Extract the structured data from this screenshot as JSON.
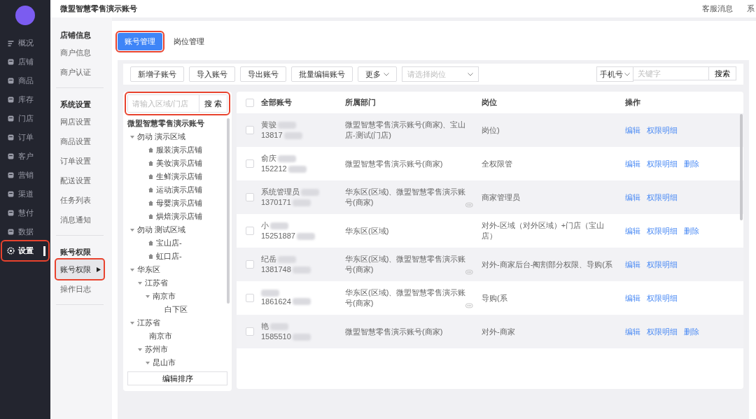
{
  "header": {
    "title": "微盟智慧零售演示账号",
    "links": [
      "客服消息",
      "系"
    ]
  },
  "nav": [
    {
      "label": "概况",
      "selected": false
    },
    {
      "label": "店铺",
      "selected": false
    },
    {
      "label": "商品",
      "selected": false
    },
    {
      "label": "库存",
      "selected": false
    },
    {
      "label": "门店",
      "selected": false
    },
    {
      "label": "订单",
      "selected": false
    },
    {
      "label": "客户",
      "selected": false
    },
    {
      "label": "营销",
      "selected": false
    },
    {
      "label": "渠道",
      "selected": false
    },
    {
      "label": "慧付",
      "selected": false
    },
    {
      "label": "数据",
      "selected": false
    },
    {
      "label": "设置",
      "selected": true,
      "highlighted": true
    }
  ],
  "submenu": [
    {
      "heading": "店铺信息",
      "items": [
        {
          "label": "商户信息",
          "selected": false
        },
        {
          "label": "商户认证",
          "selected": false
        }
      ]
    },
    {
      "heading": "系统设置",
      "items": [
        {
          "label": "网店设置",
          "selected": false
        },
        {
          "label": "商品设置",
          "selected": false
        },
        {
          "label": "订单设置",
          "selected": false
        },
        {
          "label": "配送设置",
          "selected": false
        },
        {
          "label": "任务列表",
          "selected": false
        },
        {
          "label": "消息通知",
          "selected": false
        }
      ]
    },
    {
      "heading": "账号权限",
      "items": [
        {
          "label": "账号权限",
          "selected": true,
          "highlighted": true
        },
        {
          "label": "操作日志",
          "selected": false
        }
      ]
    }
  ],
  "tabs": [
    {
      "label": "账号管理",
      "selected": true,
      "highlighted": true
    },
    {
      "label": "岗位管理",
      "selected": false
    }
  ],
  "toolbar": {
    "buttons": [
      "新增子账号",
      "导入账号",
      "导出账号",
      "批量编辑账号"
    ],
    "more": "更多",
    "role_select": {
      "placeholder": "请选择岗位"
    },
    "search_type": "手机号",
    "search": {
      "placeholder": "关键字"
    },
    "search_button": "搜索"
  },
  "tree": {
    "search": {
      "placeholder": "请输入区域/门店",
      "highlighted": true
    },
    "search_button": "搜 索",
    "root": "微盟智慧零售演示账号",
    "sort_button": "编辑排序",
    "items": [
      {
        "label": "勿动 演示区域",
        "kind": "area",
        "expanded": true,
        "children": [
          {
            "label": "服装演示店铺",
            "kind": "store"
          },
          {
            "label": "美妆演示店铺",
            "kind": "store"
          },
          {
            "label": "生鲜演示店铺",
            "kind": "store"
          },
          {
            "label": "运动演示店铺",
            "kind": "store"
          },
          {
            "label": "母婴演示店铺",
            "kind": "store"
          },
          {
            "label": "烘焙演示店铺",
            "kind": "store"
          }
        ]
      },
      {
        "label": "勿动 测试区域",
        "kind": "area",
        "expanded": true,
        "children": [
          {
            "label": "宝山店-",
            "kind": "store"
          },
          {
            "label": "虹口店-",
            "kind": "store"
          }
        ]
      },
      {
        "label": "华东区",
        "kind": "area",
        "expanded": true,
        "children": [
          {
            "label": "江苏省",
            "kind": "area",
            "expanded": true,
            "children": [
              {
                "label": "南京市",
                "kind": "area",
                "expanded": true,
                "children": [
                  {
                    "label": "白下区",
                    "kind": "leaf"
                  }
                ]
              }
            ]
          }
        ]
      },
      {
        "label": "江苏省",
        "kind": "area",
        "expanded": true,
        "children": [
          {
            "label": "南京市",
            "kind": "leaf"
          },
          {
            "label": "苏州市",
            "kind": "area",
            "expanded": true,
            "children": [
              {
                "label": "昆山市",
                "kind": "area",
                "expanded": true
              }
            ]
          }
        ]
      }
    ]
  },
  "table": {
    "all_checked": false,
    "columns": [
      "全部账号",
      "所属部门",
      "岗位",
      "操作"
    ],
    "rows": [
      {
        "checked": false,
        "name": "黄骏",
        "phone": "13817",
        "department": "微盟智慧零售演示账号(商家)、宝山店-测试(门店)",
        "more": false,
        "role": "岗位)",
        "actions": [
          "编辑",
          "权限明细"
        ]
      },
      {
        "checked": false,
        "name": "俞庆",
        "phone": "152212",
        "department": "微盟智慧零售演示账号(商家)",
        "more": false,
        "role": "全权限管",
        "actions": [
          "编辑",
          "权限明细",
          "删除"
        ]
      },
      {
        "checked": false,
        "name": "系统管理员",
        "phone": "1370171",
        "department": "华东区(区域)、微盟智慧零售演示账号(商家)",
        "more": true,
        "role": "商家管理员",
        "actions": [
          "编辑",
          "权限明细"
        ]
      },
      {
        "checked": false,
        "name": "小",
        "phone": "15251887",
        "department": "华东区(区域)",
        "more": false,
        "role": "对外-区域（对外区域）+门店（宝山店）",
        "actions": [
          "编辑",
          "权限明细",
          "删除"
        ]
      },
      {
        "checked": false,
        "name": "纪岳",
        "phone": "1381748",
        "department": "华东区(区域)、微盟智慧零售演示账号(商家)",
        "more": true,
        "role": "对外-商家后台-阉割部分权限、导购(系",
        "actions": [
          "编辑",
          "权限明细"
        ]
      },
      {
        "checked": false,
        "phone": "1861624",
        "department": "华东区(区域)、微盟智慧零售演示账号(商家)",
        "more": true,
        "role": "导购(系",
        "actions": [
          "编辑",
          "权限明细"
        ]
      },
      {
        "checked": false,
        "name": "艳",
        "phone": "1585510",
        "department": "微盟智慧零售演示账号(商家)",
        "more": false,
        "role": "对外-商家",
        "actions": [
          "编辑",
          "权限明细",
          "删除"
        ]
      }
    ]
  }
}
